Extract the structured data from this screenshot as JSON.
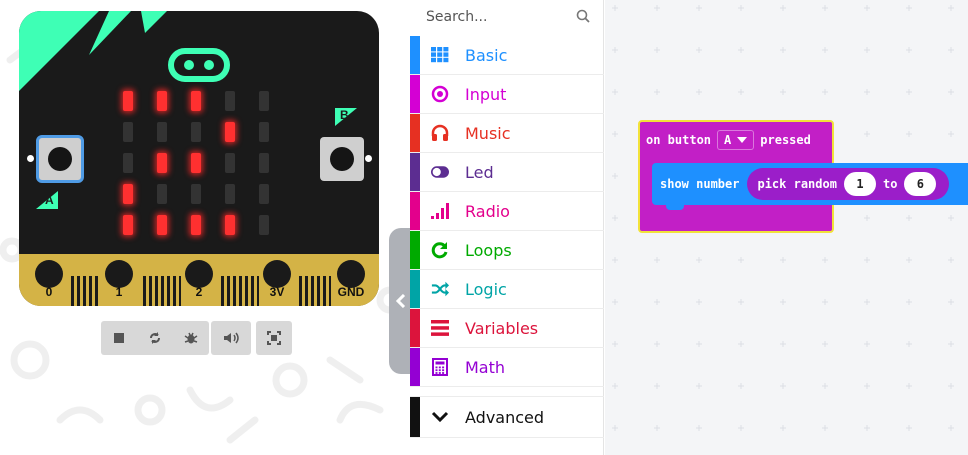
{
  "simulator": {
    "pins": [
      "0",
      "1",
      "2",
      "3V",
      "GND"
    ],
    "button_a_label": "A",
    "button_b_label": "B",
    "led_rows": [
      [
        1,
        1,
        1,
        0,
        0
      ],
      [
        0,
        0,
        0,
        1,
        0
      ],
      [
        0,
        1,
        1,
        0,
        0
      ],
      [
        1,
        0,
        0,
        0,
        0
      ],
      [
        1,
        1,
        1,
        1,
        0
      ]
    ],
    "controls": [
      "stop-icon",
      "restart-icon",
      "debug-icon",
      "mute-icon",
      "fullscreen-icon"
    ]
  },
  "toolbox": {
    "search_placeholder": "Search...",
    "categories": [
      {
        "label": "Basic",
        "color": "#1e90ff",
        "icon": "grid-icon"
      },
      {
        "label": "Input",
        "color": "#d400d4",
        "icon": "target-icon"
      },
      {
        "label": "Music",
        "color": "#e63022",
        "icon": "headphones-icon"
      },
      {
        "label": "Led",
        "color": "#5c2d91",
        "icon": "toggle-icon"
      },
      {
        "label": "Radio",
        "color": "#e3008c",
        "icon": "signal-bars-icon"
      },
      {
        "label": "Loops",
        "color": "#00aa00",
        "icon": "refresh-icon"
      },
      {
        "label": "Logic",
        "color": "#00a4a6",
        "icon": "shuffle-icon"
      },
      {
        "label": "Variables",
        "color": "#dc143c",
        "icon": "list-icon"
      },
      {
        "label": "Math",
        "color": "#9400d3",
        "icon": "calculator-icon"
      }
    ],
    "advanced_label": "Advanced",
    "advanced_color": "#111111"
  },
  "workspace": {
    "event_block": {
      "prefix": "on button",
      "button_value": "A",
      "suffix": "pressed",
      "color": "#c21fc6"
    },
    "show_number_block": {
      "label": "show number",
      "color": "#1e90ff",
      "random_label": "pick random",
      "random_color": "#9b1ec9",
      "from_value": "1",
      "to_label": "to",
      "to_value": "6"
    }
  }
}
